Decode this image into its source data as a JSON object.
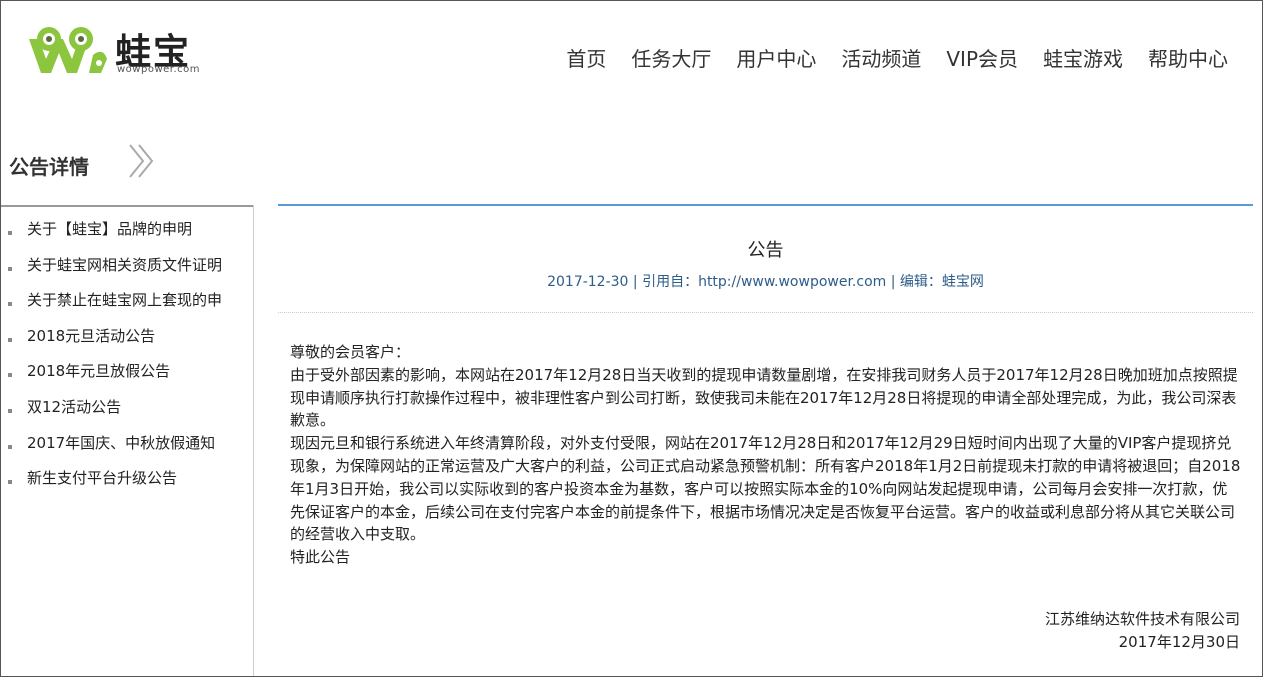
{
  "brand": {
    "name": "蛙宝",
    "domain": "wowpower.com"
  },
  "nav": [
    {
      "label": "首页"
    },
    {
      "label": "任务大厅"
    },
    {
      "label": "用户中心"
    },
    {
      "label": "活动频道"
    },
    {
      "label": "VIP会员"
    },
    {
      "label": "蛙宝游戏"
    },
    {
      "label": "帮助中心"
    }
  ],
  "section": {
    "title": "公告详情"
  },
  "sidebar": {
    "items": [
      {
        "label": "关于【蛙宝】品牌的申明"
      },
      {
        "label": "关于蛙宝网相关资质文件证明"
      },
      {
        "label": "关于禁止在蛙宝网上套现的申"
      },
      {
        "label": "2018元旦活动公告"
      },
      {
        "label": "2018年元旦放假公告"
      },
      {
        "label": "双12活动公告"
      },
      {
        "label": "2017年国庆、中秋放假通知"
      },
      {
        "label": "新生支付平台升级公告"
      }
    ]
  },
  "notice": {
    "title": "公告",
    "meta": "2017-12-30 | 引用自：http://www.wowpower.com | 编辑：蛙宝网",
    "greeting": "尊敬的会员客户：",
    "para1": "由于受外部因素的影响，本网站在2017年12月28日当天收到的提现申请数量剧增，在安排我司财务人员于2017年12月28日晚加班加点按照提现申请顺序执行打款操作过程中，被非理性客户到公司打断，致使我司未能在2017年12月28日将提现的申请全部处理完成，为此，我公司深表歉意。",
    "para2": "现因元旦和银行系统进入年终清算阶段，对外支付受限，网站在2017年12月28日和2017年12月29日短时间内出现了大量的VIP客户提现挤兑现象，为保障网站的正常运营及广大客户的利益，公司正式启动紧急预警机制：所有客户2018年1月2日前提现未打款的申请将被退回；自2018年1月3日开始，我公司以实际收到的客户投资本金为基数，客户可以按照实际本金的10%向网站发起提现申请，公司每月会安排一次打款，优先保证客户的本金，后续公司在支付完客户本金的前提条件下，根据市场情况决定是否恢复平台运营。客户的收益或利息部分将从其它关联公司的经营收入中支取。",
    "closing": "特此公告",
    "company": "江苏维纳达软件技术有限公司",
    "date": "2017年12月30日"
  },
  "colors": {
    "brand_green": "#8cc63f",
    "brand_dark": "#5a6b3a",
    "accent_blue": "#5b9bd5",
    "meta_blue": "#2d5d8a"
  }
}
